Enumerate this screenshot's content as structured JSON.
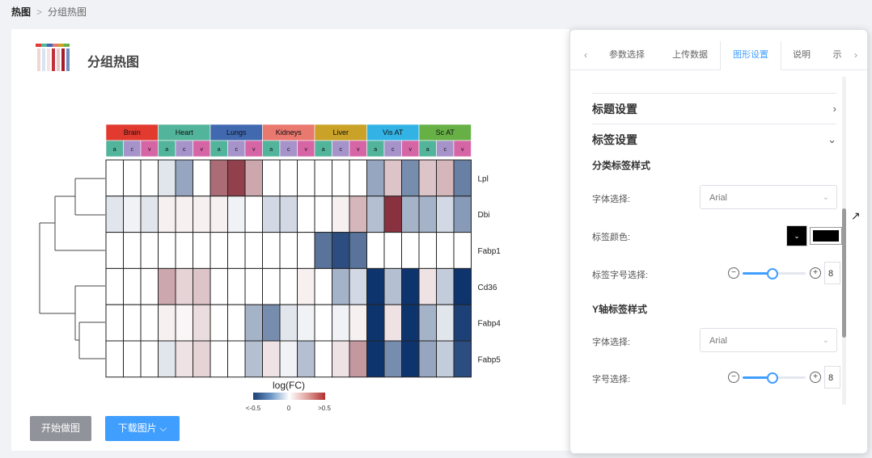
{
  "breadcrumb": {
    "root": "热图",
    "sep": ">",
    "current": "分组热图"
  },
  "page": {
    "title": "分组热图"
  },
  "buttons": {
    "start": "开始做图",
    "download": "下载图片 ⌵"
  },
  "heatmap": {
    "groups": [
      {
        "name": "Brain",
        "color": "#e23a2f"
      },
      {
        "name": "Heart",
        "color": "#52b49a"
      },
      {
        "name": "Lungs",
        "color": "#4169b0"
      },
      {
        "name": "Kidneys",
        "color": "#e9786f"
      },
      {
        "name": "Liver",
        "color": "#c9a227"
      },
      {
        "name": "Vis AT",
        "color": "#33b3e5"
      },
      {
        "name": "Sc AT",
        "color": "#66b045"
      }
    ],
    "subgroups": [
      {
        "name": "a",
        "color": "#52b49a"
      },
      {
        "name": "c",
        "color": "#a593c9"
      },
      {
        "name": "v",
        "color": "#d665a6"
      }
    ],
    "rows": [
      "Lpl",
      "Dbi",
      "Fabp1",
      "Cd36",
      "Fabp4",
      "Fabp5"
    ],
    "values": [
      [
        0,
        0,
        0,
        -0.1,
        -0.35,
        0,
        0.5,
        0.65,
        0.3,
        0,
        0,
        0,
        0,
        0,
        0,
        -0.35,
        0.2,
        -0.45,
        0.2,
        0.25,
        -0.5
      ],
      [
        -0.1,
        -0.05,
        -0.1,
        0.05,
        0.05,
        0.05,
        0.05,
        -0.05,
        0,
        -0.15,
        -0.15,
        0,
        0,
        0.05,
        0.25,
        -0.25,
        0.7,
        -0.3,
        -0.3,
        -0.15,
        -0.4
      ],
      [
        0,
        0,
        0,
        0,
        0,
        0,
        0,
        0,
        0,
        0,
        0,
        0,
        -0.55,
        -0.7,
        -0.55,
        0,
        0,
        0,
        0,
        0,
        0
      ],
      [
        0,
        0,
        0,
        0.3,
        0.15,
        0.2,
        0,
        0,
        0,
        0,
        0,
        0.05,
        0,
        -0.3,
        -0.15,
        -0.8,
        -0.25,
        -0.8,
        0.1,
        -0.2,
        -0.8
      ],
      [
        0,
        0,
        0,
        0.05,
        0.03,
        0.12,
        0,
        0,
        -0.3,
        -0.45,
        -0.1,
        -0.05,
        0,
        -0.05,
        0.05,
        -0.8,
        0.1,
        -0.8,
        -0.3,
        -0.1,
        -0.75
      ],
      [
        0,
        0,
        0,
        -0.1,
        0.1,
        0.15,
        0,
        0,
        -0.25,
        0.1,
        -0.05,
        -0.25,
        0,
        0.1,
        0.35,
        -0.8,
        -0.45,
        -0.8,
        -0.35,
        -0.2,
        -0.7
      ]
    ],
    "legend": {
      "title": "log(FC)",
      "min_label": "<-0.5",
      "mid_label": "0",
      "max_label": ">0.5"
    }
  },
  "panel": {
    "tabs": [
      "参数选择",
      "上传数据",
      "图形设置",
      "说明",
      "示"
    ],
    "active_tab": 2,
    "tab_prev": "‹",
    "tab_next": "›",
    "sections": {
      "title_settings": "标题设置",
      "label_settings": "标签设置"
    },
    "category_label_style": "分类标签样式",
    "font_select_label": "字体选择:",
    "font_value": "Arial",
    "label_color_label": "标签颜色:",
    "label_size_label": "标签字号选择:",
    "size_value": "8",
    "y_axis_label_style": "Y轴标签样式",
    "y_font_select_label": "字体选择:",
    "y_font_value": "Arial",
    "y_size_label": "字号选择:",
    "y_size_value": "8",
    "colors": {
      "accent": "#409eff",
      "label_color": "#000000"
    }
  }
}
